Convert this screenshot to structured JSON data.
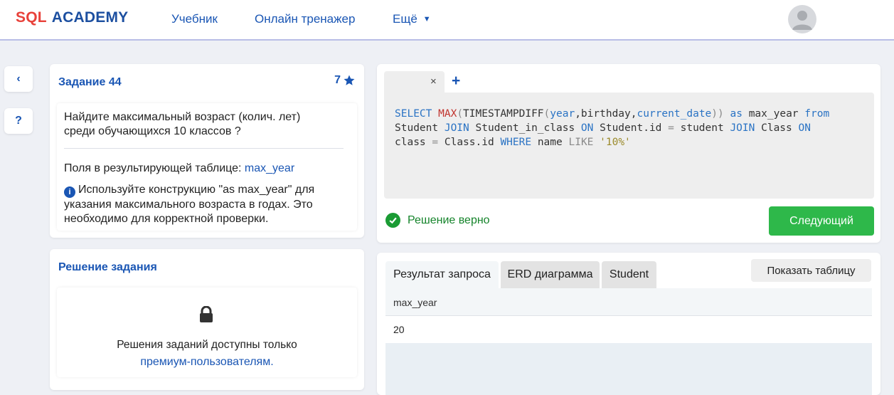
{
  "header": {
    "logo_sql": "SQL",
    "logo_academy": "ACADEMY",
    "nav": [
      "Учебник",
      "Онлайн тренажер",
      "Ещё"
    ],
    "avatar_icon": "user-avatar-icon"
  },
  "rail": {
    "back": "‹",
    "help": "?"
  },
  "task": {
    "title": "Задание 44",
    "points": "7",
    "question": "Найдите максимальный возраст (колич. лет) среди обучающихся 10 классов ?",
    "fields_label": "Поля в результирующей таблице:",
    "fields_value": "max_year",
    "hint": "Используйте конструкцию \"as max_year\" для указания максимального возраста в годах. Это необходимо для корректной проверки."
  },
  "solution": {
    "title": "Решение задания",
    "locked_text_1": "Решения заданий доступны только",
    "locked_link": "премиум-пользователям."
  },
  "editor": {
    "close": "×",
    "add": "+",
    "code_tokens": [
      {
        "t": "SELECT ",
        "c": "kw"
      },
      {
        "t": "MAX",
        "c": "fn"
      },
      {
        "t": "(",
        "c": "op"
      },
      {
        "t": "TIMESTAMPDIFF",
        "c": ""
      },
      {
        "t": "(",
        "c": "op"
      },
      {
        "t": "year",
        "c": "kw"
      },
      {
        "t": ",birthday,",
        "c": ""
      },
      {
        "t": "current_date",
        "c": "kw"
      },
      {
        "t": ")) ",
        "c": "op"
      },
      {
        "t": "as ",
        "c": "kw"
      },
      {
        "t": "max_year ",
        "c": ""
      },
      {
        "t": "from",
        "c": "kw"
      },
      {
        "t": "\nStudent ",
        "c": ""
      },
      {
        "t": "JOIN ",
        "c": "kw"
      },
      {
        "t": "Student_in_class ",
        "c": ""
      },
      {
        "t": "ON ",
        "c": "kw"
      },
      {
        "t": "Student.id ",
        "c": ""
      },
      {
        "t": "= ",
        "c": "op"
      },
      {
        "t": "student ",
        "c": ""
      },
      {
        "t": "JOIN ",
        "c": "kw"
      },
      {
        "t": "Class ",
        "c": ""
      },
      {
        "t": "ON",
        "c": "kw"
      },
      {
        "t": "\nclass ",
        "c": ""
      },
      {
        "t": "= ",
        "c": "op"
      },
      {
        "t": "Class.id ",
        "c": ""
      },
      {
        "t": "WHERE ",
        "c": "kw"
      },
      {
        "t": "name ",
        "c": ""
      },
      {
        "t": "LIKE ",
        "c": "op"
      },
      {
        "t": "'10%'",
        "c": "str"
      }
    ]
  },
  "status": {
    "text": "Решение верно",
    "next_button": "Следующий"
  },
  "results": {
    "tabs": [
      "Результат запроса",
      "ERD диаграмма",
      "Student"
    ],
    "show_table": "Показать таблицу",
    "columns": [
      "max_year"
    ],
    "rows": [
      [
        "20"
      ]
    ]
  },
  "colors": {
    "brand_red": "#e8413a",
    "brand_blue": "#1a56b4",
    "success_green": "#2eb84a"
  }
}
